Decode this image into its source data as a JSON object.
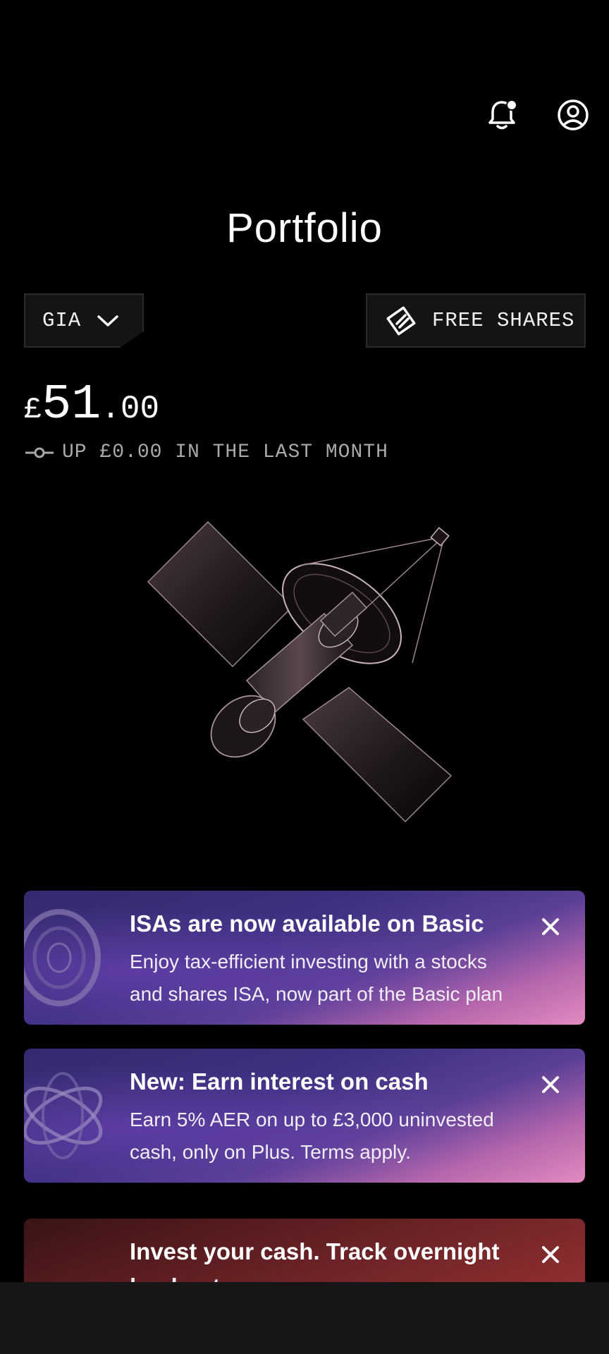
{
  "header": {
    "icons": [
      "bell-icon",
      "profile-icon"
    ],
    "notification_dot": true
  },
  "page_title": "Portfolio",
  "account_selector": {
    "label": "GIA"
  },
  "free_shares_button": {
    "label": "FREE SHARES"
  },
  "balance": {
    "currency": "£",
    "whole": "51",
    "decimal": ".00",
    "change_text": "UP £0.00 IN THE LAST MONTH"
  },
  "hero_illustration": "satellite",
  "promos": [
    {
      "title": "ISAs are now available on Basic",
      "body": "Enjoy tax-efficient investing with a stocks and shares ISA, now part of the Basic plan"
    },
    {
      "title": "New: Earn interest on cash",
      "body": "Earn 5% AER on up to £3,000 uninvested cash, only on Plus. Terms apply."
    },
    {
      "title": "Invest your cash. Track overnight",
      "body": "bank rates"
    }
  ],
  "colors": {
    "background": "#000000",
    "promo_purple": "#3f3183",
    "promo_pink": "#e48ac0",
    "promo_red": "#8a2d2f",
    "muted_text": "#a9a9a9"
  }
}
